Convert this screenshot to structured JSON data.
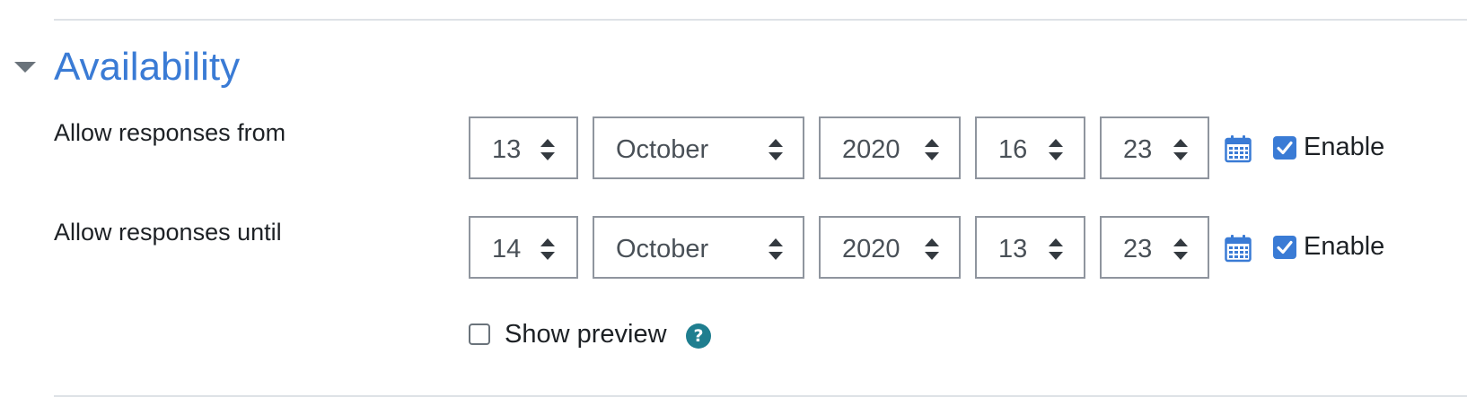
{
  "section": {
    "title": "Availability"
  },
  "rows": {
    "from": {
      "label": "Allow responses from",
      "day": "13",
      "month": "October",
      "year": "2020",
      "hour": "16",
      "minute": "23",
      "enabled": true,
      "enable_label": "Enable"
    },
    "until": {
      "label": "Allow responses until",
      "day": "14",
      "month": "October",
      "year": "2020",
      "hour": "13",
      "minute": "23",
      "enabled": true,
      "enable_label": "Enable"
    }
  },
  "preview": {
    "label": "Show preview",
    "checked": false,
    "help_icon_text": "?"
  },
  "icons": {
    "collapse": "chevron-down-icon",
    "calendar": "calendar-icon",
    "help": "question-circle-icon"
  },
  "colors": {
    "accent": "#3a7bd5",
    "help": "#1f7e8f",
    "border": "#8f959e",
    "divider": "#dee2e6"
  }
}
